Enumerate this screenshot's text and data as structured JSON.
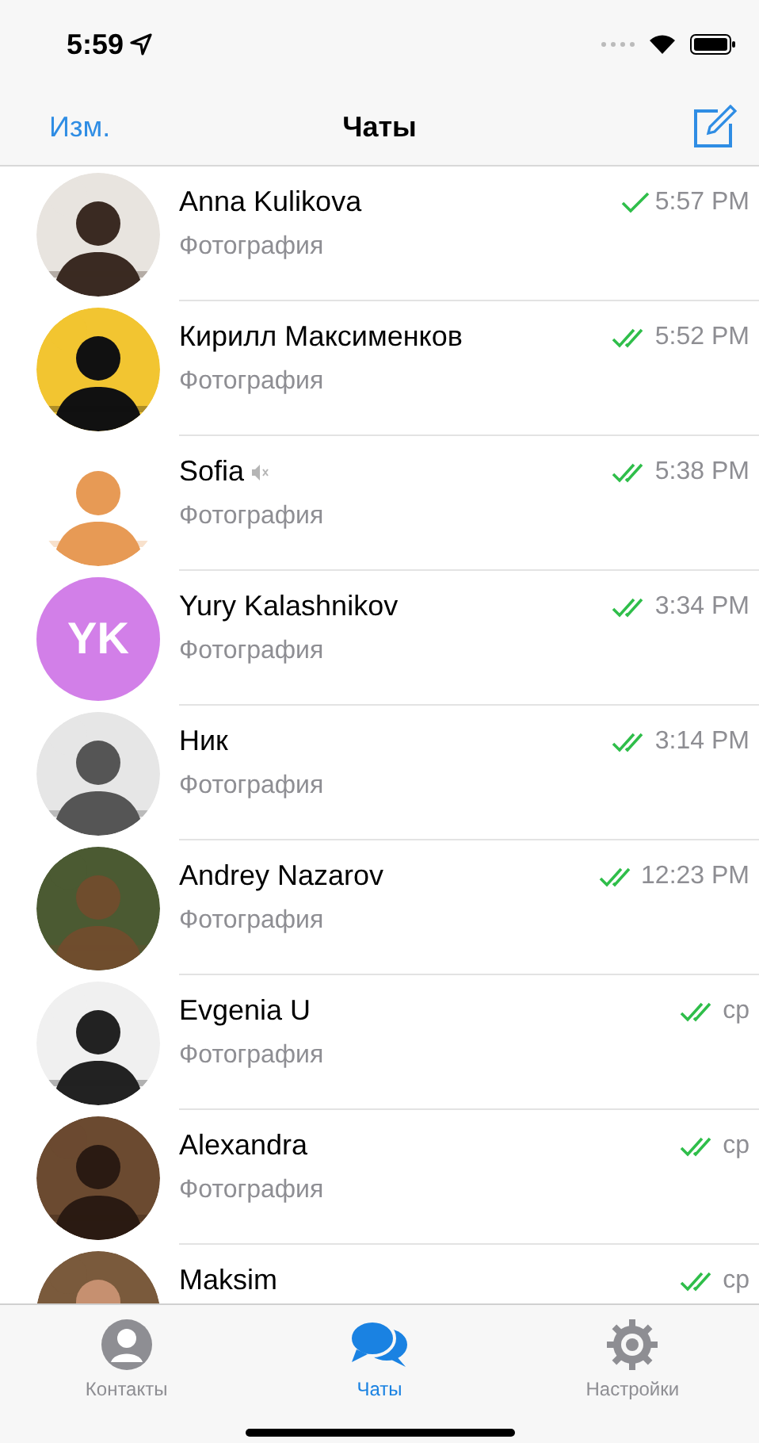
{
  "status_bar": {
    "time": "5:59"
  },
  "nav": {
    "edit": "Изм.",
    "title": "Чаты"
  },
  "chats": [
    {
      "name": "Anna Kulikova",
      "message": "Фотография",
      "time": "5:57 PM",
      "read": false,
      "muted": false
    },
    {
      "name": "Кирилл Максименков",
      "message": "Фотография",
      "time": "5:52 PM",
      "read": true,
      "muted": false
    },
    {
      "name": "Sofia",
      "message": "Фотография",
      "time": "5:38 PM",
      "read": true,
      "muted": true
    },
    {
      "name": "Yury Kalashnikov",
      "message": "Фотография",
      "time": "3:34 PM",
      "read": true,
      "muted": false,
      "avatar": {
        "kind": "initials",
        "initials": "YK",
        "color": "#d27fe8"
      }
    },
    {
      "name": "Ник",
      "message": "Фотография",
      "time": "3:14 PM",
      "read": true,
      "muted": false
    },
    {
      "name": "Andrey Nazarov",
      "message": "Фотография",
      "time": "12:23 PM",
      "read": true,
      "muted": false
    },
    {
      "name": "Evgenia U",
      "message": "Фотография",
      "time": "ср",
      "read": true,
      "muted": false
    },
    {
      "name": "Alexandra",
      "message": "Фотография",
      "time": "ср",
      "read": true,
      "muted": false
    },
    {
      "name": "Maksim",
      "time": "ср",
      "read": true,
      "muted": false
    }
  ],
  "tabs": [
    {
      "label": "Контакты",
      "selected": false
    },
    {
      "label": "Чаты",
      "selected": true
    },
    {
      "label": "Настройки",
      "selected": false
    }
  ]
}
